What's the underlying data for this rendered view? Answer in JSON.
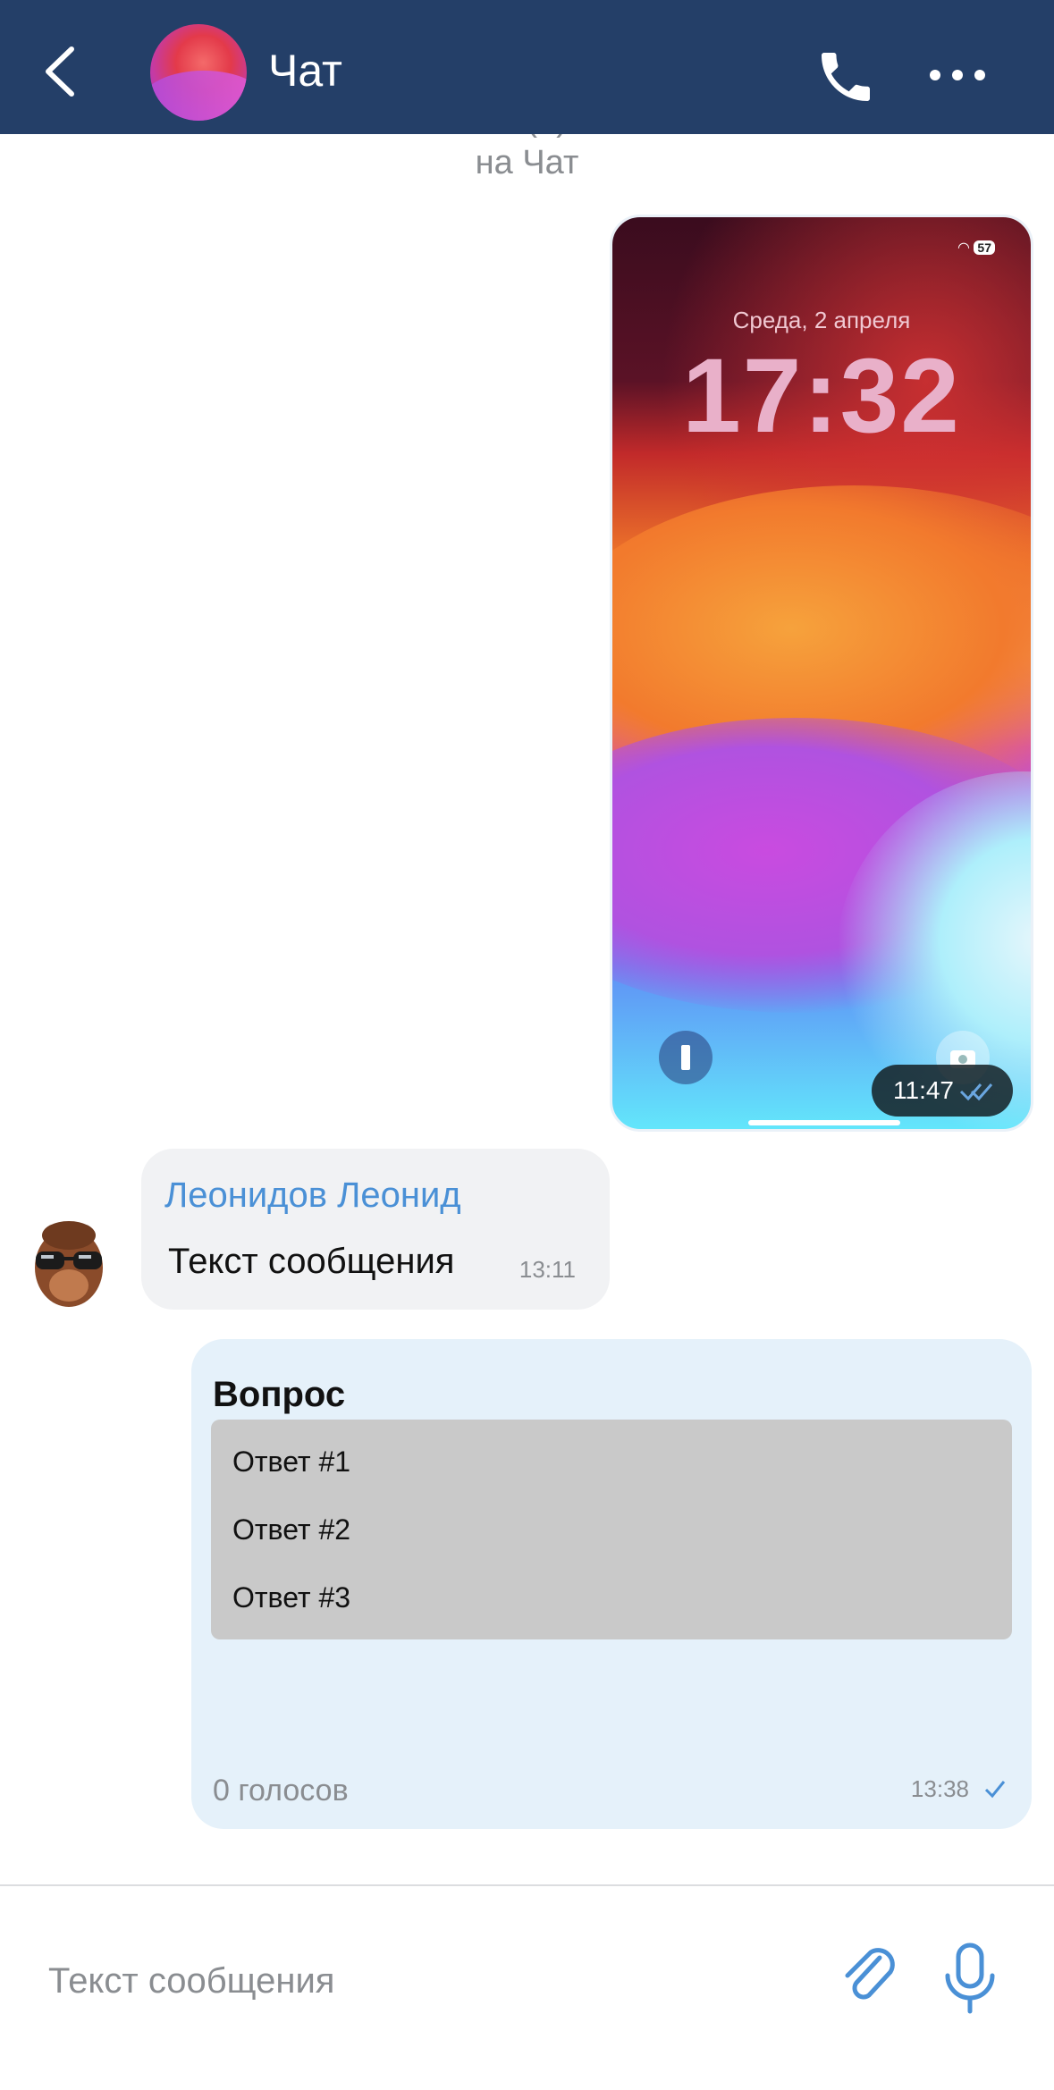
{
  "header": {
    "title": "Чат",
    "back_icon": "chevron-left-icon",
    "call_icon": "phone-icon",
    "more_icon": "more-dots-icon",
    "background": "#243f68"
  },
  "system_message": {
    "line1": "Глебов Глеб изменил(а) название комнаты",
    "line2": "на Чат"
  },
  "image_message": {
    "lock_date": "Среда, 2 апреля",
    "lock_time": "17:32",
    "battery": "57",
    "time": "11:47",
    "status_icon": "double-check-icon"
  },
  "incoming_message": {
    "sender": "Леонидов Леонид",
    "text": "Текст сообщения",
    "time": "13:11",
    "avatar": "monkey-sunglasses-avatar"
  },
  "poll": {
    "question": "Вопрос",
    "options": [
      "Ответ #1",
      "Ответ #2",
      "Ответ #3"
    ],
    "votes": "0 голосов",
    "time": "13:38",
    "status_icon": "check-icon"
  },
  "composer": {
    "placeholder": "Текст сообщения",
    "attach_icon": "paperclip-icon",
    "mic_icon": "microphone-icon"
  },
  "colors": {
    "accent": "#4a90d6",
    "incoming_bubble": "#f1f2f4",
    "outgoing_bubble": "#e5f1fa"
  }
}
